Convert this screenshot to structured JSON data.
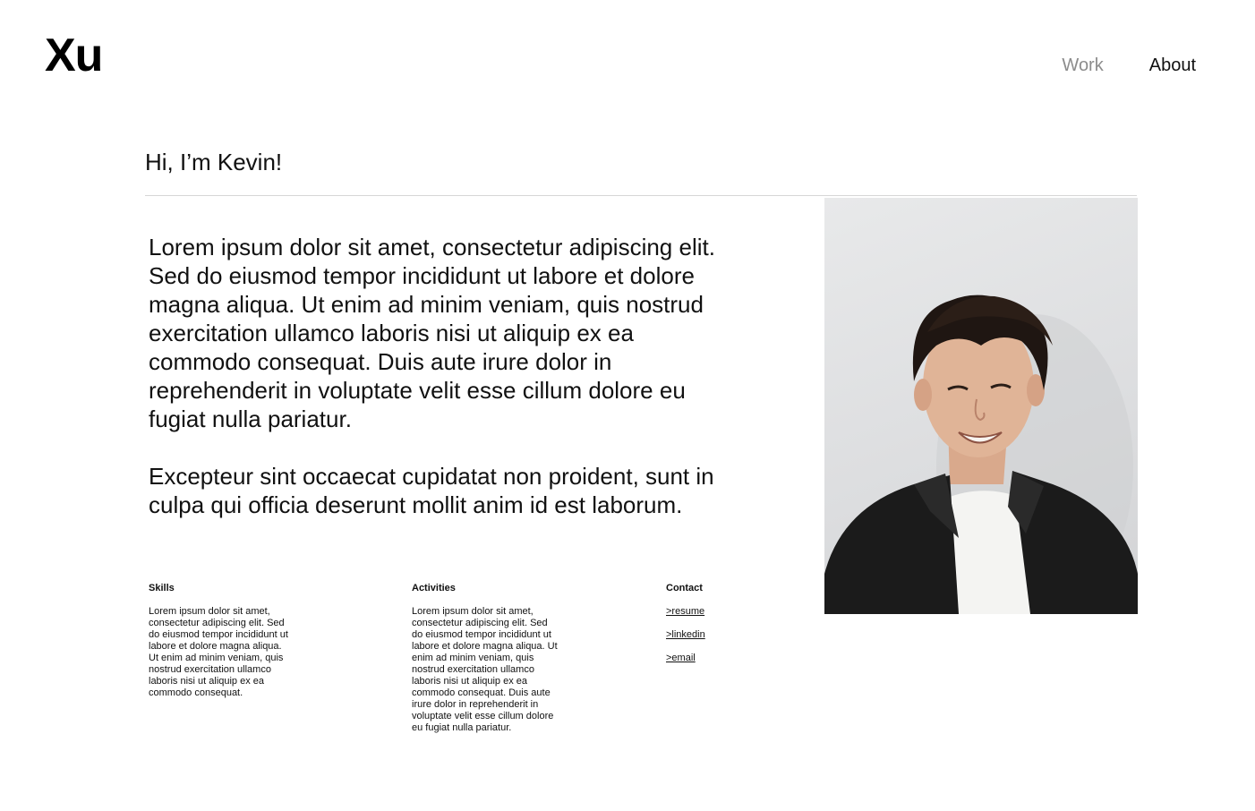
{
  "header": {
    "logo": "Xu",
    "nav": [
      {
        "label": "Work",
        "active": false
      },
      {
        "label": "About",
        "active": true
      }
    ]
  },
  "intro": {
    "greeting": "Hi, I’m Kevin!",
    "paragraphs": [
      "Lorem ipsum dolor sit amet, consectetur adipiscing elit. Sed do eiusmod tempor incididunt ut labore et dolore magna aliqua. Ut enim ad minim veniam, quis nostrud exercitation ullamco laboris nisi ut aliquip ex ea commodo consequat. Duis aute irure dolor in reprehenderit in voluptate velit esse cillum dolore eu fugiat nulla pariatur.",
      "Excepteur sint occaecat cupidatat non proident, sunt in culpa qui officia deserunt mollit anim id est laborum."
    ]
  },
  "skills": {
    "title": "Skills",
    "text": "Lorem ipsum dolor sit amet, consectetur adipiscing elit. Sed do eiusmod tempor incididunt ut labore et dolore magna aliqua. Ut enim ad minim veniam, quis nostrud exercitation ullamco laboris nisi ut aliquip ex ea commodo consequat."
  },
  "activities": {
    "title": "Activities",
    "text": "Lorem ipsum dolor sit amet, consectetur adipiscing elit. Sed do eiusmod tempor incididunt ut labore et dolore magna aliqua. Ut enim ad minim veniam, quis nostrud exercitation ullamco laboris nisi ut aliquip ex ea commodo consequat. Duis aute irure dolor in reprehenderit in voluptate velit esse cillum dolore eu fugiat nulla pariatur."
  },
  "contact": {
    "title": "Contact",
    "links": [
      ">resume",
      ">linkedin",
      ">email"
    ]
  },
  "colors": {
    "text": "#111111",
    "nav_inactive": "#8c8c8c",
    "divider": "#d6d6d6",
    "background": "#ffffff"
  }
}
